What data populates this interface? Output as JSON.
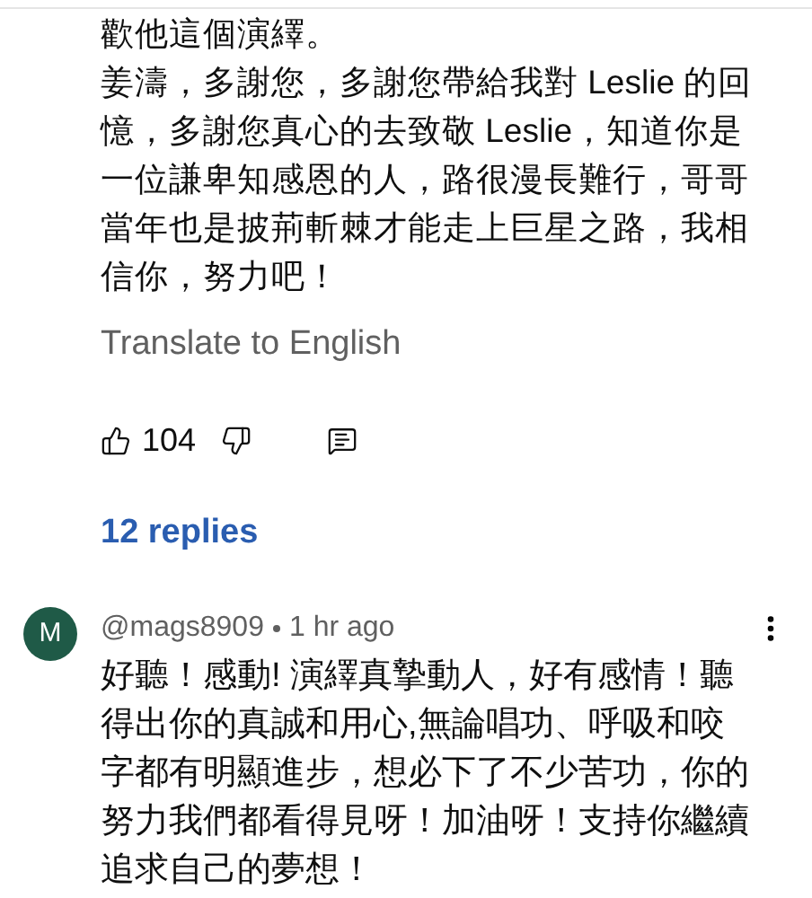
{
  "comment": {
    "paragraphs": [
      "歡他這個演繹。",
      "姜濤，多謝您，多謝您帶給我對 Leslie 的回憶，多謝您真心的去致敬 Leslie，知道你是一位謙卑知感恩的人，路很漫長難行，哥哥當年也是披荊斬棘才能走上巨星之路，我相信你，努力吧！"
    ],
    "translate": "Translate to English",
    "likes": "104",
    "replies": "12 replies"
  },
  "reply": {
    "avatar": "M",
    "author": "@mags8909",
    "time": "1 hr ago",
    "text": "好聽！感動! 演繹真摯動人，好有感情！聽得出你的真誠和用心,無論唱功、呼吸和咬字都有明顯進步，想必下了不少苦功，你的努力我們都看得見呀！加油呀！支持你繼續追求自己的夢想！"
  }
}
